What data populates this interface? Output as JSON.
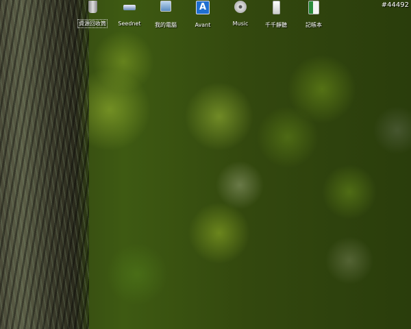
{
  "desktop": {
    "icons": [
      {
        "label": "資源回收筒",
        "icon": "recycle-bin-icon"
      },
      {
        "label": "Seednet",
        "icon": "drive-icon"
      },
      {
        "label": "我的電腦",
        "icon": "computer-icon"
      },
      {
        "label": "Avant",
        "icon": "avant-browser-icon"
      },
      {
        "label": "Music",
        "icon": "music-icon"
      },
      {
        "label": "千千靜聽",
        "icon": "player-icon"
      },
      {
        "label": "記帳本",
        "icon": "spreadsheet-icon"
      }
    ],
    "counter": "#44492"
  }
}
